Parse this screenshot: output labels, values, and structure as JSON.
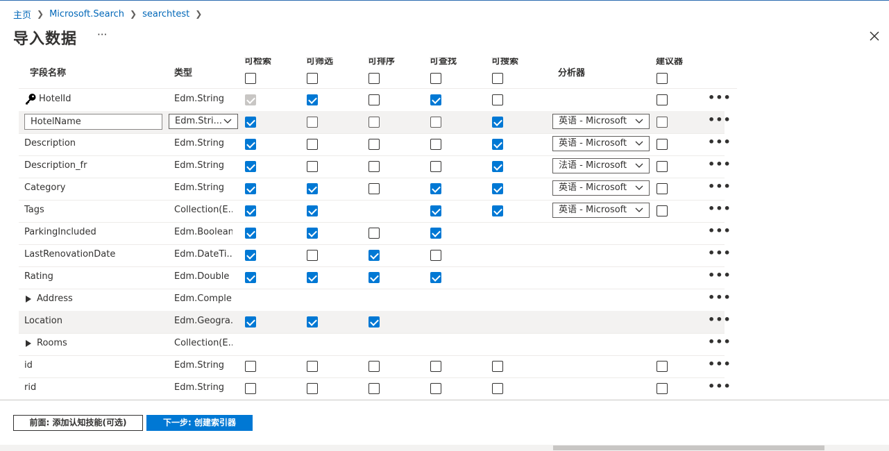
{
  "breadcrumb": {
    "items": [
      "主页",
      "Microsoft.Search",
      "searchtest"
    ]
  },
  "page": {
    "title": "导入数据",
    "more": "···"
  },
  "columns": {
    "name": "字段名称",
    "type": "类型",
    "retrievable": "可检索",
    "filterable": "可筛选",
    "sortable": "可排序",
    "facetable": "可查找",
    "searchable": "可搜索",
    "analyzer": "分析器",
    "suggester": "建议器"
  },
  "rows": [
    {
      "name": "HotelId",
      "type": "Edm.String",
      "key": true,
      "r": "disabled",
      "f": true,
      "s": false,
      "fa": true,
      "se": false,
      "analyzer": null,
      "sug": false
    },
    {
      "name": "HotelName",
      "type": "Edm.Stri...",
      "editing": true,
      "r": true,
      "f": false,
      "s": false,
      "fa": false,
      "se": true,
      "analyzer": "英语 - Microsoft",
      "sug": false
    },
    {
      "name": "Description",
      "type": "Edm.String",
      "r": true,
      "f": false,
      "s": false,
      "fa": false,
      "se": true,
      "analyzer": "英语 - Microsoft",
      "sug": false
    },
    {
      "name": "Description_fr",
      "type": "Edm.String",
      "r": true,
      "f": false,
      "s": false,
      "fa": false,
      "se": true,
      "analyzer": "法语 - Microsoft",
      "sug": false
    },
    {
      "name": "Category",
      "type": "Edm.String",
      "r": true,
      "f": true,
      "s": false,
      "fa": true,
      "se": true,
      "analyzer": "英语 - Microsoft",
      "sug": false
    },
    {
      "name": "Tags",
      "type": "Collection(E...",
      "r": true,
      "f": true,
      "s": null,
      "fa": true,
      "se": true,
      "analyzer": "英语 - Microsoft",
      "sug": false
    },
    {
      "name": "ParkingIncluded",
      "type": "Edm.Boolean",
      "r": true,
      "f": true,
      "s": false,
      "fa": true,
      "se": null,
      "analyzer": null,
      "sug": null
    },
    {
      "name": "LastRenovationDate",
      "type": "Edm.DateTi...",
      "r": true,
      "f": false,
      "s": true,
      "fa": false,
      "se": null,
      "analyzer": null,
      "sug": null
    },
    {
      "name": "Rating",
      "type": "Edm.Double",
      "r": true,
      "f": true,
      "s": true,
      "fa": true,
      "se": null,
      "analyzer": null,
      "sug": null
    },
    {
      "name": "Address",
      "type": "Edm.Comple...",
      "expandable": true,
      "r": null,
      "f": null,
      "s": null,
      "fa": null,
      "se": null,
      "analyzer": null,
      "sug": null
    },
    {
      "name": "Location",
      "type": "Edm.Geogra...",
      "highlight": true,
      "r": true,
      "f": true,
      "s": true,
      "fa": null,
      "se": null,
      "analyzer": null,
      "sug": null
    },
    {
      "name": "Rooms",
      "type": "Collection(E...",
      "expandable": true,
      "r": null,
      "f": null,
      "s": null,
      "fa": null,
      "se": null,
      "analyzer": null,
      "sug": null
    },
    {
      "name": "id",
      "type": "Edm.String",
      "r": false,
      "f": false,
      "s": false,
      "fa": false,
      "se": false,
      "analyzer": null,
      "sug": false
    },
    {
      "name": "rid",
      "type": "Edm.String",
      "r": false,
      "f": false,
      "s": false,
      "fa": false,
      "se": false,
      "analyzer": null,
      "sug": false
    }
  ],
  "row_more": "•••",
  "footer": {
    "prev_label": "前面: 添加认知技能(可选)",
    "next_label": "下一步: 创建索引器"
  },
  "colors": {
    "accent": "#0078d4",
    "link": "#0067b8"
  }
}
